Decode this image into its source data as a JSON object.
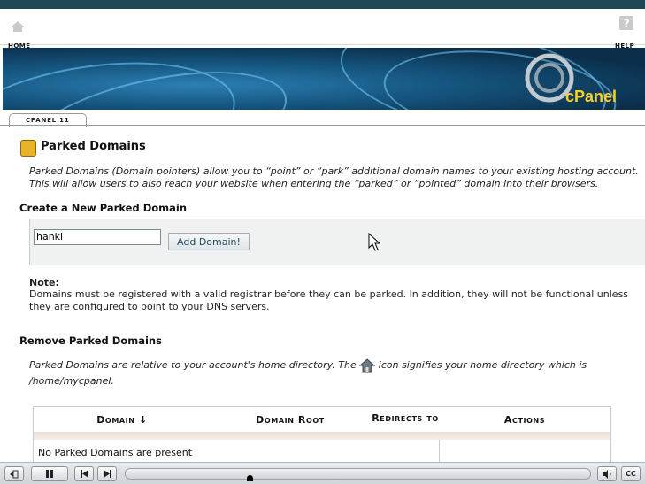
{
  "nav": {
    "home_label": "HOME",
    "help_label": "HELP"
  },
  "banner": {
    "logo_text": "cPanel"
  },
  "breadcrumb": {
    "label": "CPANEL 11"
  },
  "page": {
    "title": "Parked Domains",
    "description_line1": "Parked Domains (Domain pointers) allow you to “point” or “park” additional domain names to your existing hosting account.",
    "description_line2": "This will allow users to also reach your website when entering the “parked” or “pointed” domain into their browsers."
  },
  "create": {
    "heading": "Create a New Parked Domain",
    "input_value": "hanki",
    "button_label": "Add Domain!"
  },
  "note": {
    "heading": "Note:",
    "line1": "Domains must be registered with a valid registrar before they can be parked. In addition, they will not be functional unless",
    "line2": "they are configured to point to your DNS servers."
  },
  "remove": {
    "heading": "Remove Parked Domains",
    "desc_before": "Parked Domains are relative to your account's home directory. The",
    "desc_after": "icon signifies your home directory which is",
    "home_path": "/home/mycpanel."
  },
  "table": {
    "headers": [
      "Domain ↓",
      "Domain Root",
      "Redirects to",
      "Actions"
    ],
    "empty_message": "No Parked Domains are present"
  },
  "player": {
    "cc_label": "CC"
  },
  "colors": {
    "accent": "#234a66",
    "banner": "#15557f",
    "logo": "#ffd21f"
  }
}
